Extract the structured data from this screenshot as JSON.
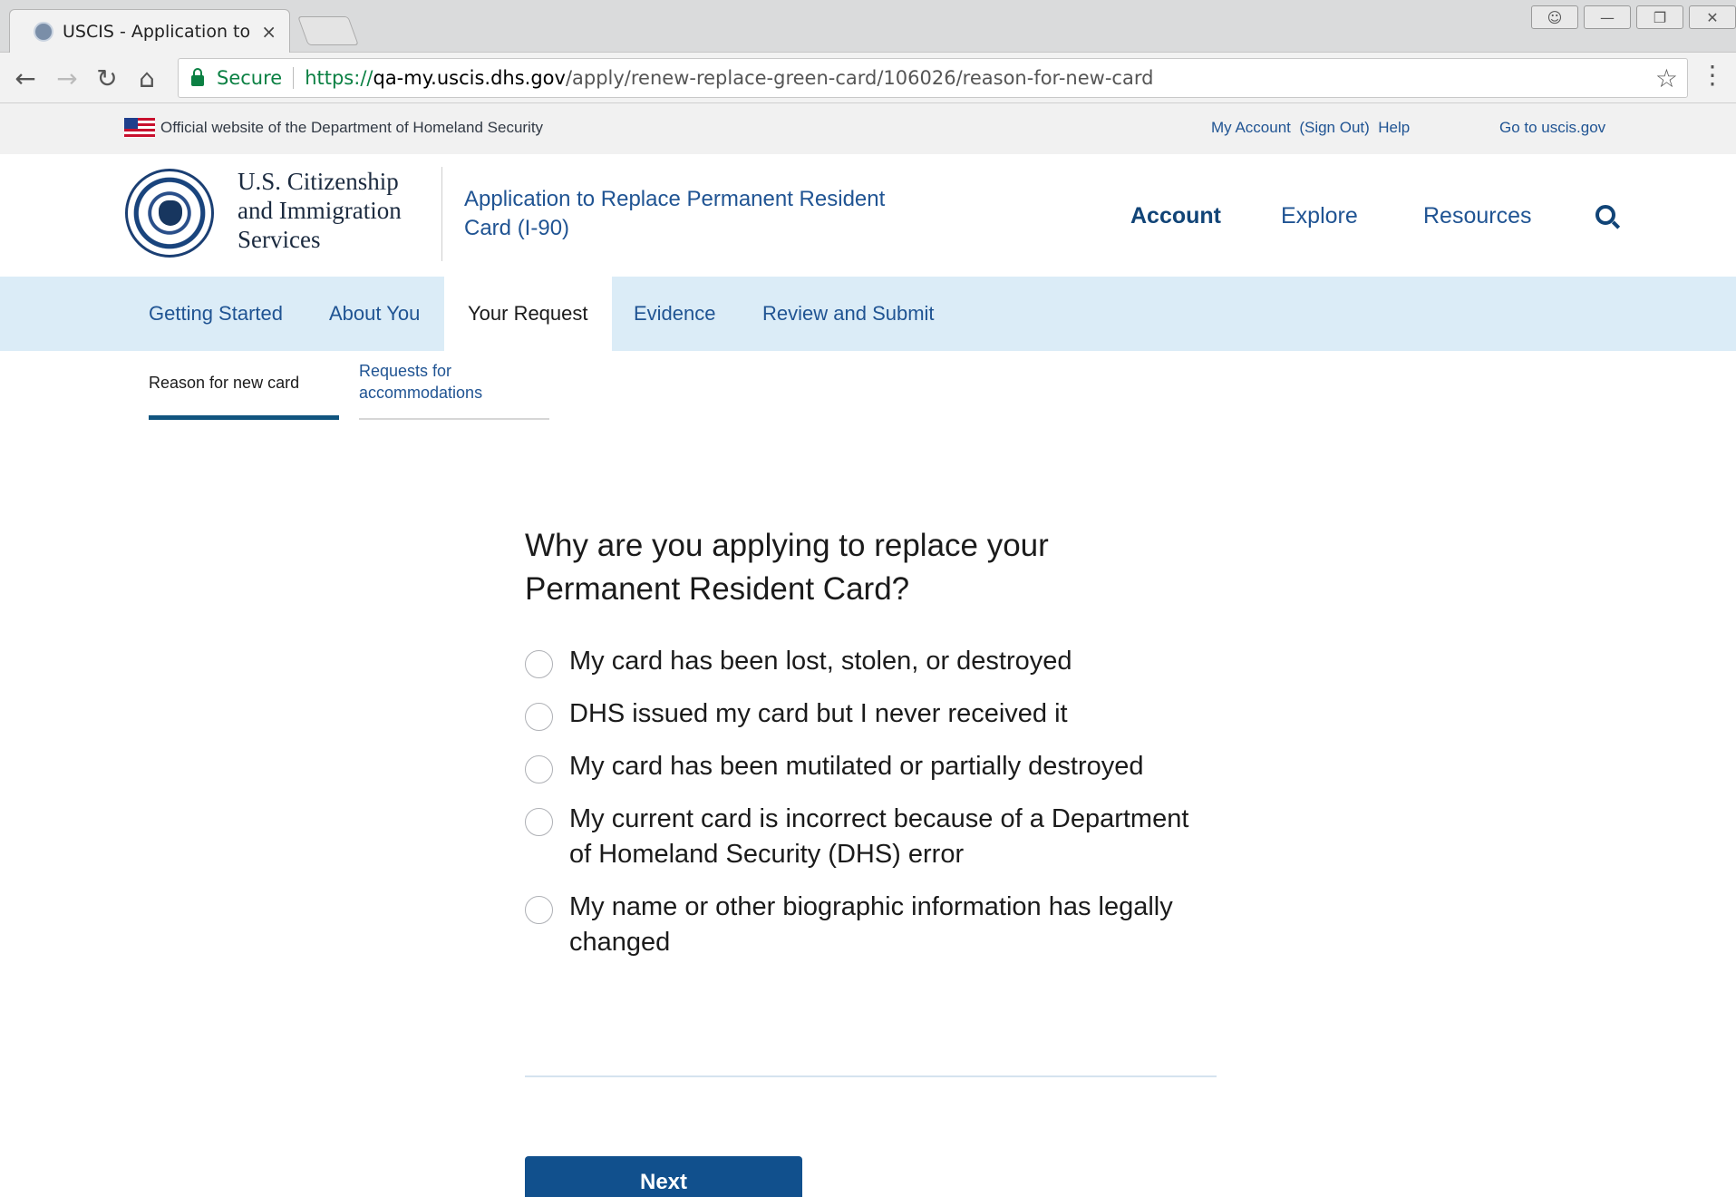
{
  "browser": {
    "tab_title": "USCIS - Application to Re",
    "tab_close": "×",
    "secure_label": "Secure",
    "url_scheme": "https://",
    "url_host": "qa-my.uscis.dhs.gov",
    "url_path": "/apply/renew-replace-green-card/106026/reason-for-new-card",
    "back": "←",
    "forward": "→",
    "reload": "↻",
    "home": "⌂",
    "star": "☆",
    "menu": "⋮",
    "win_user": "👤",
    "win_min": "—",
    "win_restore": "❐",
    "win_close": "✕"
  },
  "banner": {
    "official_text": "Official website of the Department of Homeland Security",
    "account_links": "My Account  (Sign Out)  Help",
    "go_to": "Go to uscis.gov"
  },
  "header": {
    "agency_name": "U.S. Citizenship and Immigration Services",
    "app_title": "Application to Replace Permanent Resident Card (I-90)",
    "nav": {
      "account": "Account",
      "explore": "Explore",
      "resources": "Resources"
    }
  },
  "steps": [
    {
      "label": "Getting Started"
    },
    {
      "label": "About You"
    },
    {
      "label": "Your Request"
    },
    {
      "label": "Evidence"
    },
    {
      "label": "Review and Submit"
    }
  ],
  "substeps": [
    {
      "label": "Reason for new card"
    },
    {
      "label": "Requests for accommodations"
    }
  ],
  "form": {
    "question": "Why are you applying to replace your Permanent Resident Card?",
    "options": [
      "My card has been lost, stolen, or destroyed",
      "DHS issued my card but I never received it",
      "My card has been mutilated or partially destroyed",
      "My current card is incorrect because of a Department of Homeland Security (DHS) error",
      "My name or other biographic information has legally changed"
    ],
    "next_label": "Next"
  },
  "colors": {
    "brand_blue": "#205493",
    "nav_bg": "#dbecf7",
    "button_bg": "#11508d"
  }
}
